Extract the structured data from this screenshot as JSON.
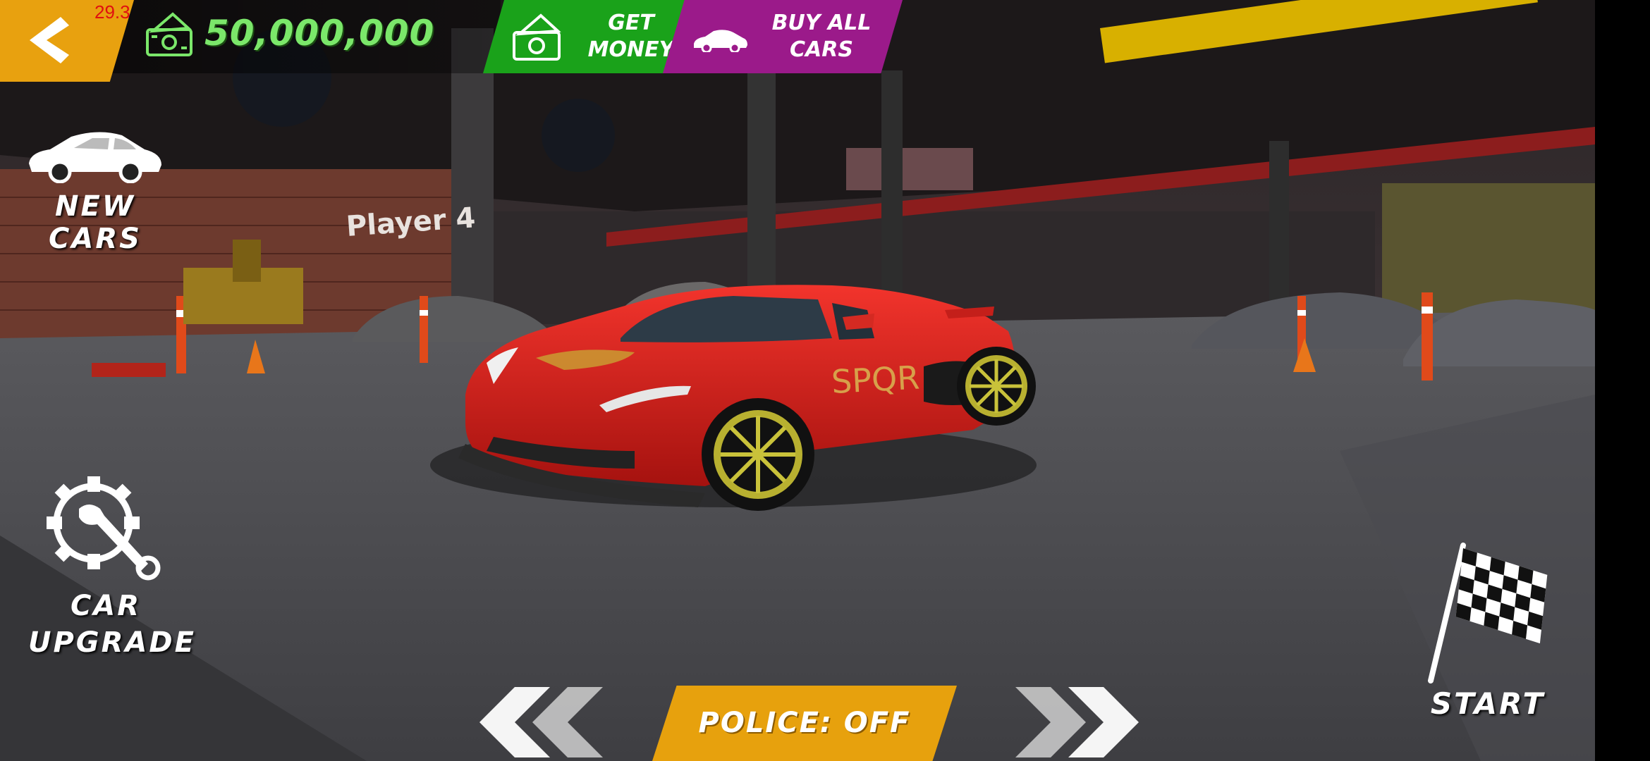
{
  "hud": {
    "fps": "29.3",
    "money": "50,000,000"
  },
  "buttons": {
    "get_money": "GET\nMONEY",
    "buy_all_cars": "BUY ALL\nCARS",
    "new_cars": "NEW CARS",
    "car_upgrade": "CAR\nUPGRADE",
    "start": "START",
    "police": "POLICE: OFF"
  },
  "scene": {
    "player_sign": "Player 4",
    "car_decal": "SPQR"
  },
  "colors": {
    "accent_orange": "#e8a10f",
    "money_green": "#7be76a",
    "get_money_green": "#1aa21a",
    "buy_cars_purple": "#9b1a8a",
    "car_red": "#d81e1e"
  }
}
